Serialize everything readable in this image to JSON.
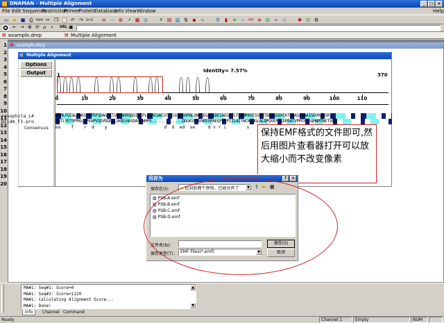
{
  "app": {
    "title": "DNAMAN - Multiple Alignment",
    "menu": [
      "File",
      "Edit",
      "Sequence",
      "Restriction",
      "Primer",
      "Protein",
      "Database",
      "Info",
      "View",
      "Window"
    ],
    "help": "Help",
    "url_label": "URL"
  },
  "tabs": [
    "example.dmp",
    "Multiple Alignment"
  ],
  "row_numbers": [
    "1",
    "2",
    "3",
    "4",
    "5",
    "6",
    "7",
    "8",
    "9",
    "10",
    "11",
    "12",
    "13",
    "14",
    "15",
    "16",
    "17",
    "18",
    "19",
    "20"
  ],
  "example_window": {
    "title": "example.dmp"
  },
  "alignment_window": {
    "title": "Multiple Alignment",
    "options_button": "Options",
    "output_button": "Output",
    "identity": "Identity=  7.57%",
    "range_start": "1",
    "range_end": "370",
    "ticks": [
      "0",
      "10",
      "20",
      "30",
      "40",
      "50",
      "60",
      "70",
      "80",
      "90",
      "100",
      "110"
    ],
    "names": [
      "rosophila_L4",
      "btidm_F1.pro",
      "Consensus"
    ],
    "seq_rows": [
      "MSMLFQIALMAKSGVTRFSDAGHKTVADAKRSQGINIPLDCRCGACGTCKCKAESGPALQNPKEGALSDEIAEGYVLTCQMPASCSVVKTDPASSQVCKTKQASFEAAISDVRQLSR",
      "MSTLYETVPRGLVPEAPVSDVDQDLLSKELHASDASFWHPS.............DDGKSFFENEESPAEQPQEPIILAITWCNGQGLALDPQVEPTKERSATVPMTPTSQMAMTNETVEQ",
      "ms    f    r  d    y                      d  d  ed  se     d v r i        s"
    ]
  },
  "annotation": {
    "text": "保持EMF格式的文件即可,然后用图片查看器打开可以放大缩小而不改变像素"
  },
  "save_dialog": {
    "title": "另存为",
    "save_in_label": "保存在(I):",
    "save_in_value": "比对后两个序列，已经分开了",
    "files": [
      "PSB-A.emf",
      "PSB-B.emf",
      "PSB-C.emf",
      "PSB-D.emf"
    ],
    "filename_label": "文件名(N):",
    "filename_value": "",
    "filetype_label": "保存类型(T):",
    "filetype_value": "EMF Files(*.emf)",
    "save_button": "保存(S)",
    "cancel_button": "取消",
    "help_button": "?",
    "close_button": "×"
  },
  "log": {
    "lines": [
      "MA#1: Seq#1: Score=0",
      "MA#1: Seq#2: Score=1120",
      "MA#1: Calculating Alignment Score...",
      "MA#1: Done!"
    ],
    "tabs": [
      "Info",
      "Channel",
      "Command"
    ]
  },
  "statusbar": {
    "ready": "Ready",
    "channel": "Channel 1",
    "empty": "Empty",
    "num": "NUM"
  },
  "colors": {
    "titlebar": "#0a47b8",
    "navy_highlight": "#0a1f6e",
    "cyan_highlight": "#7ff3f0",
    "annotation_red": "#cc2222"
  }
}
